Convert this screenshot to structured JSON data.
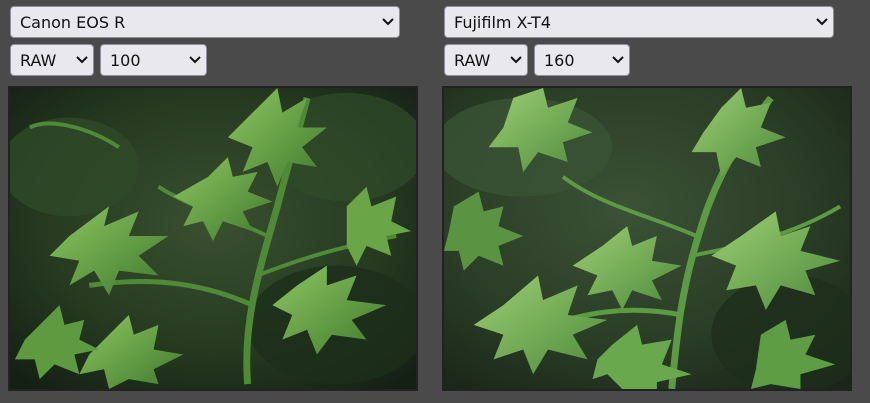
{
  "left": {
    "camera": "Canon EOS R",
    "format": "RAW",
    "iso": "100"
  },
  "right": {
    "camera": "Fujifilm X-T4",
    "format": "RAW",
    "iso": "160"
  },
  "icons": {
    "dropdown": "chevron-down-icon",
    "image": "plant-leaves-photo"
  },
  "colors": {
    "page_bg": "#4a4a4a",
    "select_bg": "#e9e9ed",
    "leaf_light": "#6fa84a",
    "leaf_dark": "#2f5a25",
    "background_dark": "#1e2a1a"
  }
}
